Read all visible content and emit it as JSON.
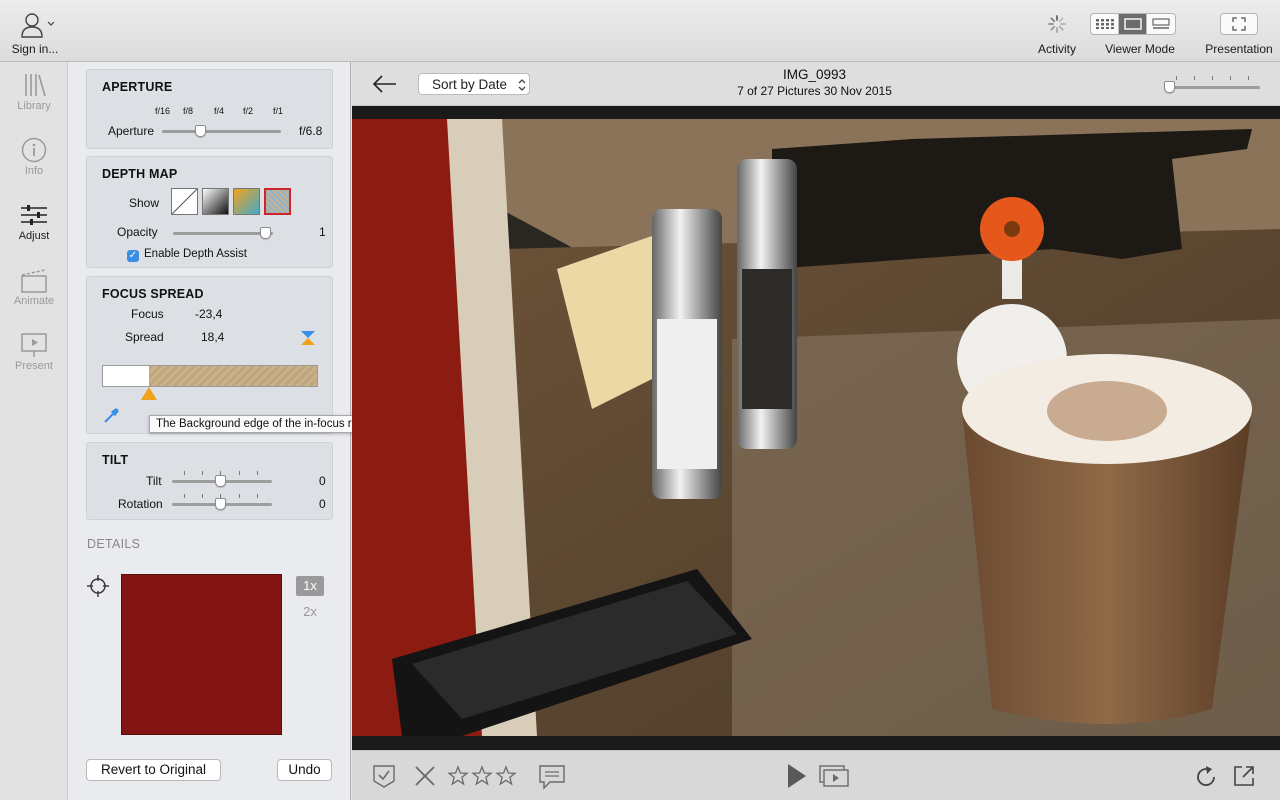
{
  "toolbar": {
    "sign_in_label": "Sign in...",
    "activity_label": "Activity",
    "viewer_mode_label": "Viewer Mode",
    "presentation_label": "Presentation"
  },
  "rail": {
    "items": [
      {
        "label": "Library",
        "icon": "library-icon"
      },
      {
        "label": "Info",
        "icon": "info-icon"
      },
      {
        "label": "Adjust",
        "icon": "sliders-icon"
      },
      {
        "label": "Animate",
        "icon": "clapper-icon"
      },
      {
        "label": "Present",
        "icon": "presentation-icon"
      }
    ],
    "active": "Adjust"
  },
  "aperture": {
    "title": "APERTURE",
    "ticks": [
      "f/16",
      "f/8",
      "f/4",
      "f/2",
      "f/1"
    ],
    "label": "Aperture",
    "value": "f/6.8"
  },
  "depth_map": {
    "title": "DEPTH MAP",
    "show_label": "Show",
    "opacity_label": "Opacity",
    "opacity_value": "1",
    "enable_label": "Enable Depth Assist",
    "enabled": true
  },
  "focus_spread": {
    "title": "FOCUS SPREAD",
    "focus_label": "Focus",
    "focus_value": "-23,4",
    "spread_label": "Spread",
    "spread_value": "18,4",
    "tooltip": "The Background edge of the in-focus region."
  },
  "tilt": {
    "title": "TILT",
    "tilt_label": "Tilt",
    "tilt_value": "0",
    "rotation_label": "Rotation",
    "rotation_value": "0"
  },
  "details": {
    "title": "DETAILS",
    "zoom_1x": "1x",
    "zoom_2x": "2x"
  },
  "buttons": {
    "revert": "Revert to Original",
    "undo": "Undo"
  },
  "viewer": {
    "sort_label": "Sort by Date",
    "image_name": "IMG_0993",
    "image_info": "7 of 27 Pictures  30 Nov 2015"
  },
  "colors": {
    "accent": "#3a8ee6",
    "focus_marker": "#f0a21a",
    "depth_stripe": "#c9b18a"
  }
}
